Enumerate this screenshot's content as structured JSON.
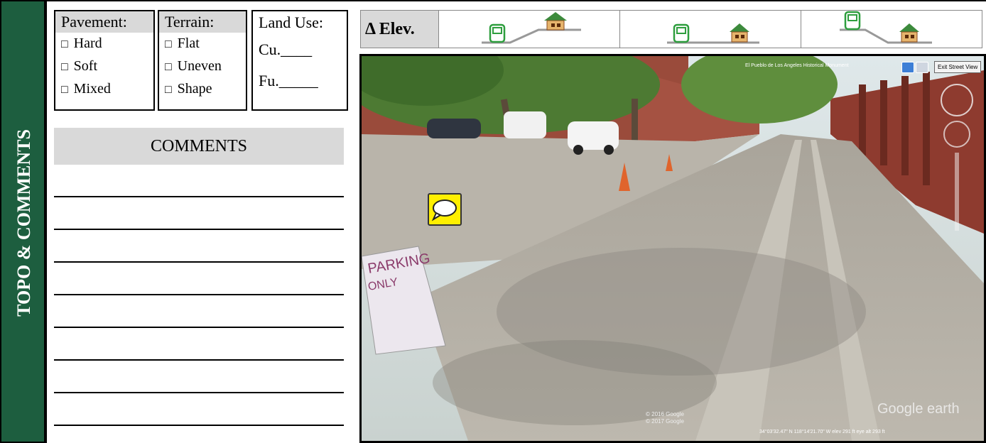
{
  "sidebar": {
    "title": "TOPO & COMMENTS"
  },
  "pavement": {
    "header": "Pavement:",
    "options": [
      "Hard",
      "Soft",
      "Mixed"
    ]
  },
  "terrain": {
    "header": "Terrain:",
    "options": [
      "Flat",
      "Uneven",
      "Shape"
    ]
  },
  "land_use": {
    "header": "Land Use:",
    "current": "Cu.____",
    "future": "Fu._____"
  },
  "checkbox_glyph": "□",
  "comments": {
    "header": "COMMENTS"
  },
  "elevation": {
    "label": "Δ Elev."
  },
  "street_view": {
    "location": "El Pueblo de Los Angeles Historical Monument",
    "exit_label": "Exit Street View",
    "copyright_1": "© 2016 Google",
    "copyright_2": "© 2017 Google",
    "brand": "Google earth",
    "status": "34°03'32.47\" N 118°14'21.70\" W elev 291 ft eye alt 293 ft"
  },
  "colors": {
    "sidebar": "#1d5e3f",
    "header_gray": "#d9d9d9",
    "comment_yellow": "#ffef00",
    "bus_green": "#2e9e3e"
  }
}
